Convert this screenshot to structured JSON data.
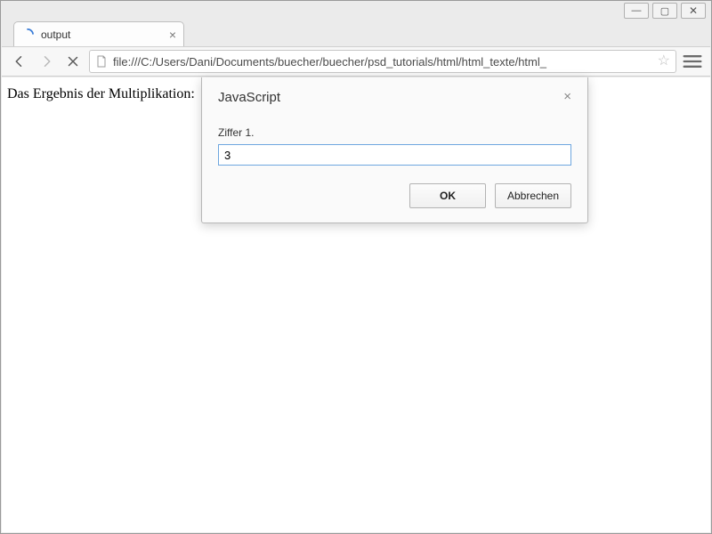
{
  "window": {
    "controls": {
      "minimize": "—",
      "maximize": "▢",
      "close": "✕"
    }
  },
  "tab": {
    "title": "output",
    "close_glyph": "×"
  },
  "toolbar": {
    "url": "file:///C:/Users/Dani/Documents/buecher/buecher/psd_tutorials/html/html_texte/html_",
    "star_glyph": "☆"
  },
  "page": {
    "heading": "Das Ergebnis der Multiplikation:"
  },
  "dialog": {
    "title": "JavaScript",
    "close_glyph": "×",
    "message": "Ziffer 1.",
    "input_value": "3",
    "ok_label": "OK",
    "cancel_label": "Abbrechen"
  }
}
